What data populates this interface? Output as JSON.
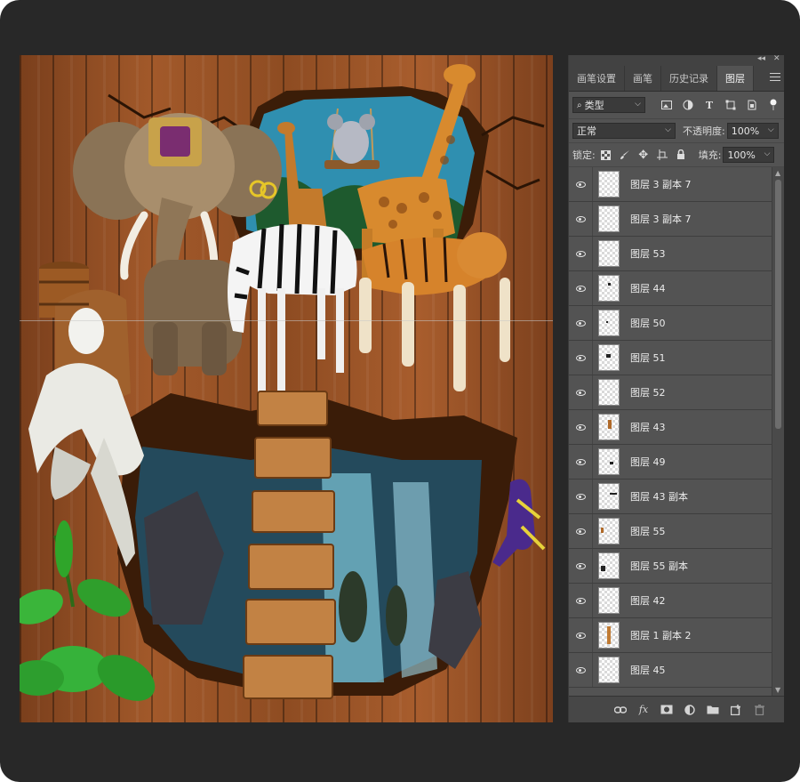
{
  "panel": {
    "tabs": [
      {
        "label": "画笔设置",
        "active": false
      },
      {
        "label": "画笔",
        "active": false
      },
      {
        "label": "历史记录",
        "active": false
      },
      {
        "label": "图层",
        "active": true
      }
    ],
    "collapse_glyph": "◂◂",
    "close_glyph": "✕",
    "filter": {
      "value": "类型"
    },
    "blend_mode": "正常",
    "opacity_label": "不透明度:",
    "opacity_value": "100%",
    "lock_label": "锁定:",
    "fill_label": "填充:",
    "fill_value": "100%",
    "layers": [
      {
        "name": "图层 3 副本 7"
      },
      {
        "name": "图层 3 副本 7"
      },
      {
        "name": "图层 53"
      },
      {
        "name": "图层 44"
      },
      {
        "name": "图层 50"
      },
      {
        "name": "图层 51"
      },
      {
        "name": "图层 52"
      },
      {
        "name": "图层 43"
      },
      {
        "name": "图层 49"
      },
      {
        "name": "图层 43 副本"
      },
      {
        "name": "图层 55"
      },
      {
        "name": "图层 55 副本"
      },
      {
        "name": "图层 42"
      },
      {
        "name": "图层 1 副本 2"
      },
      {
        "name": "图层 45"
      }
    ]
  },
  "colors": {
    "app_bg": "#282828",
    "panel_bg": "#535353",
    "tab_bar_bg": "#424242"
  },
  "icons": {
    "filter": "search-icon",
    "image_filter": "image-icon",
    "adjust_filter": "adjustment-icon",
    "type_filter": "type-icon",
    "shape_filter": "shape-icon",
    "smart_filter": "smart-object-icon",
    "lock_pixels": "lock-transparent-icon",
    "lock_paint": "brush-icon",
    "lock_move": "move-icon",
    "lock_artboard": "artboard-icon",
    "lock_all": "lock-icon",
    "link": "link-icon",
    "fx": "fx-icon",
    "mask": "mask-icon",
    "adjustment": "adjustment-layer-icon",
    "folder": "folder-icon",
    "new_layer": "new-layer-icon",
    "trash": "trash-icon"
  }
}
